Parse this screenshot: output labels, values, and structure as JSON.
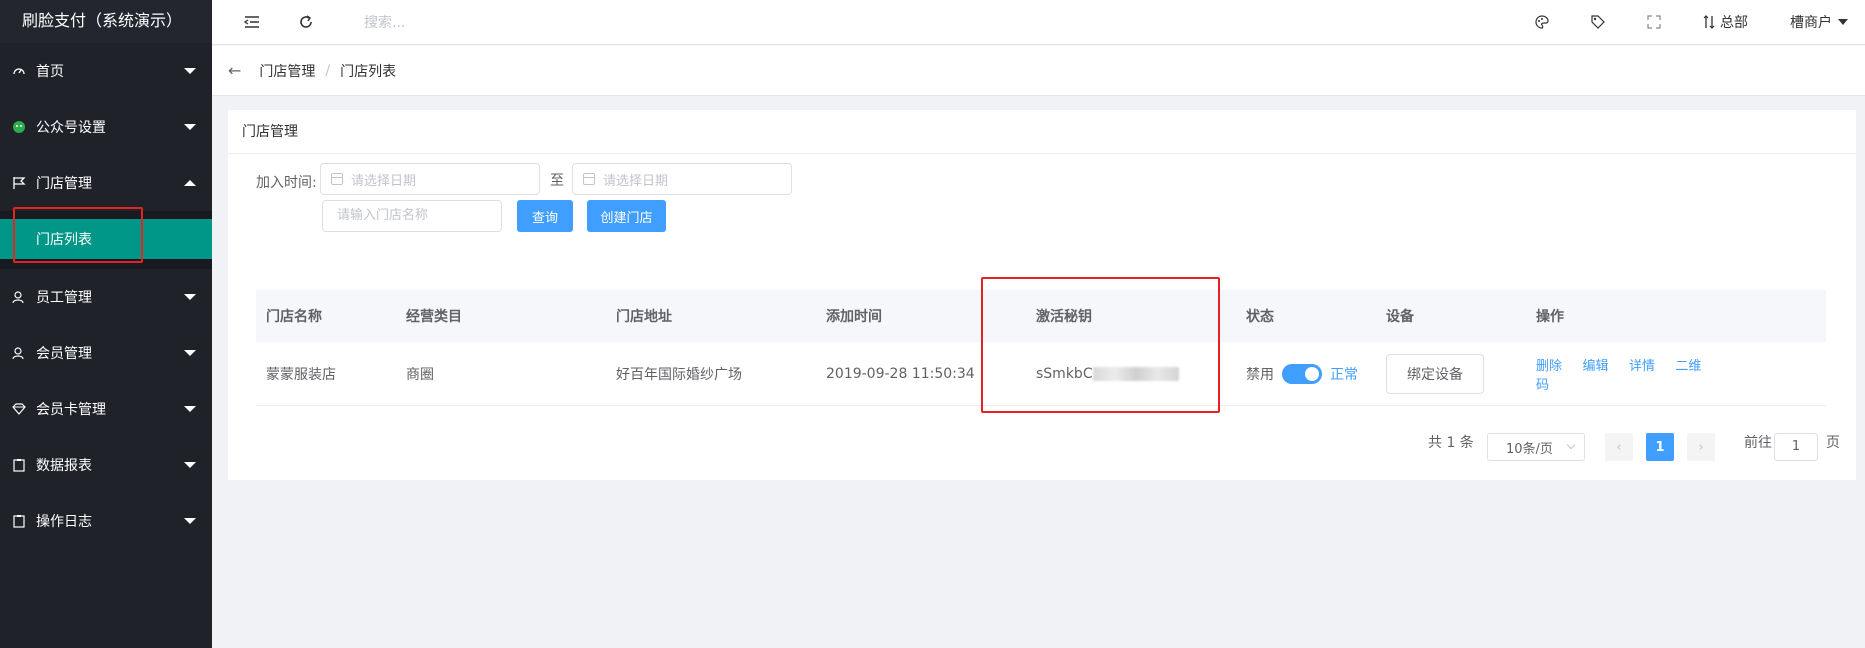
{
  "app": {
    "title": "刷脸支付（系统演示）"
  },
  "sidebar": {
    "items": [
      {
        "label": "首页",
        "icon": "dashboard-icon"
      },
      {
        "label": "公众号设置",
        "icon": "wechat-icon"
      },
      {
        "label": "门店管理",
        "icon": "flag-icon",
        "expanded": true
      },
      {
        "label": "员工管理",
        "icon": "user-icon"
      },
      {
        "label": "会员管理",
        "icon": "user-icon"
      },
      {
        "label": "会员卡管理",
        "icon": "diamond-icon"
      },
      {
        "label": "数据报表",
        "icon": "clipboard-icon"
      },
      {
        "label": "操作日志",
        "icon": "clipboard-icon"
      }
    ],
    "submenu": {
      "label": "门店列表",
      "active": true
    }
  },
  "header": {
    "search_placeholder": "搜索...",
    "hq_label": "总部",
    "user_label": "槽商户"
  },
  "breadcrumb": {
    "items": [
      "门店管理",
      "门店列表"
    ]
  },
  "card": {
    "title": "门店管理"
  },
  "filters": {
    "join_time_label": "加入时间:",
    "date_placeholder": "请选择日期",
    "to_label": "至",
    "name_placeholder": "请输入门店名称",
    "query_button": "查询",
    "create_button": "创建门店"
  },
  "table": {
    "headers": [
      "门店名称",
      "经营类目",
      "门店地址",
      "添加时间",
      "激活秘钥",
      "状态",
      "设备",
      "操作"
    ],
    "rows": [
      {
        "name": "蒙蒙服装店",
        "category": "商圈",
        "address": "好百年国际婚纱广场",
        "added": "2019-09-28 11:50:34",
        "key_prefix": "sSmkbC",
        "status_off": "禁用",
        "status_on": "正常",
        "device_button": "绑定设备",
        "actions": [
          "删除",
          "编辑",
          "详情",
          "二维码"
        ]
      }
    ]
  },
  "pagination": {
    "total": "共 1 条",
    "page_size": "10条/页",
    "current_page": "1",
    "goto_label": "前往",
    "goto_value": "1",
    "page_unit": "页"
  },
  "colors": {
    "sidebar_bg": "#20222a",
    "active_menu": "#009688",
    "primary": "#409eff",
    "highlight_box": "#e62222"
  }
}
